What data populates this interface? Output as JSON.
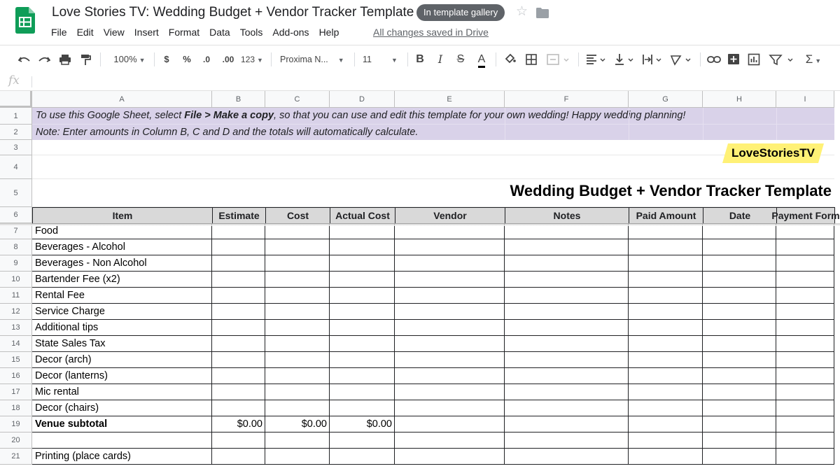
{
  "app": {
    "doc_title": "Love Stories TV: Wedding Budget + Vendor Tracker Template",
    "gallery_badge": "In template gallery",
    "saved_status": "All changes saved in Drive",
    "menu": [
      "File",
      "Edit",
      "View",
      "Insert",
      "Format",
      "Data",
      "Tools",
      "Add-ons",
      "Help"
    ],
    "brand_color": "#0f9d58"
  },
  "toolbar": {
    "zoom": "100%",
    "currency": "$",
    "percent": "%",
    "dec_less": ".0",
    "dec_more": ".00",
    "more_formats": "123",
    "font": "Proxima N...",
    "font_size": "11",
    "bold": "B",
    "italic": "I",
    "strike": "S",
    "text_color": "A"
  },
  "formula_bar": {
    "icon": "fx",
    "value": ""
  },
  "sheet": {
    "columns": [
      "A",
      "B",
      "C",
      "D",
      "E",
      "F",
      "G",
      "H",
      "I"
    ],
    "row_numbers": [
      "1",
      "2",
      "3",
      "4",
      "5",
      "6",
      "7",
      "8",
      "9",
      "10",
      "11",
      "12",
      "13",
      "14",
      "15",
      "16",
      "17",
      "18",
      "19",
      "20",
      "21"
    ],
    "note_line1_pre": "To use this Google Sheet, select ",
    "note_line1_bold": "File > Make a copy",
    "note_line1_post": ", so that you can use and edit this template for your own wedding! Happy wedding planning!",
    "note_line2": "Note: Enter amounts in Column B, C and D and the totals will automatically calculate.",
    "logo_text": "LoveStoriesTV",
    "title": "Wedding Budget + Vendor Tracker Template",
    "headers": [
      "Item",
      "Estimate",
      "Cost",
      "Actual Cost",
      "Vendor",
      "Notes",
      "Paid Amount",
      "Date",
      "Payment Form"
    ],
    "rows": [
      {
        "item": "Food",
        "estimate": "",
        "cost": "",
        "actual": ""
      },
      {
        "item": "Beverages - Alcohol",
        "estimate": "",
        "cost": "",
        "actual": ""
      },
      {
        "item": "Beverages - Non Alcohol",
        "estimate": "",
        "cost": "",
        "actual": ""
      },
      {
        "item": "Bartender Fee (x2)",
        "estimate": "",
        "cost": "",
        "actual": ""
      },
      {
        "item": "Rental Fee",
        "estimate": "",
        "cost": "",
        "actual": ""
      },
      {
        "item": "Service Charge",
        "estimate": "",
        "cost": "",
        "actual": ""
      },
      {
        "item": "Additional tips",
        "estimate": "",
        "cost": "",
        "actual": ""
      },
      {
        "item": "State Sales Tax",
        "estimate": "",
        "cost": "",
        "actual": ""
      },
      {
        "item": "Decor (arch)",
        "estimate": "",
        "cost": "",
        "actual": ""
      },
      {
        "item": "Decor (lanterns)",
        "estimate": "",
        "cost": "",
        "actual": ""
      },
      {
        "item": "Mic rental",
        "estimate": "",
        "cost": "",
        "actual": ""
      },
      {
        "item": "Decor (chairs)",
        "estimate": "",
        "cost": "",
        "actual": ""
      },
      {
        "item": "Venue subtotal",
        "estimate": "$0.00",
        "cost": "$0.00",
        "actual": "$0.00",
        "bold": true
      },
      {
        "item": "",
        "estimate": "",
        "cost": "",
        "actual": ""
      },
      {
        "item": "Printing (place cards)",
        "estimate": "",
        "cost": "",
        "actual": ""
      }
    ],
    "colors": {
      "note_bg": "#d9d2e9",
      "header_bg": "#d9d9d9",
      "logo_bg": "#fff176"
    }
  }
}
